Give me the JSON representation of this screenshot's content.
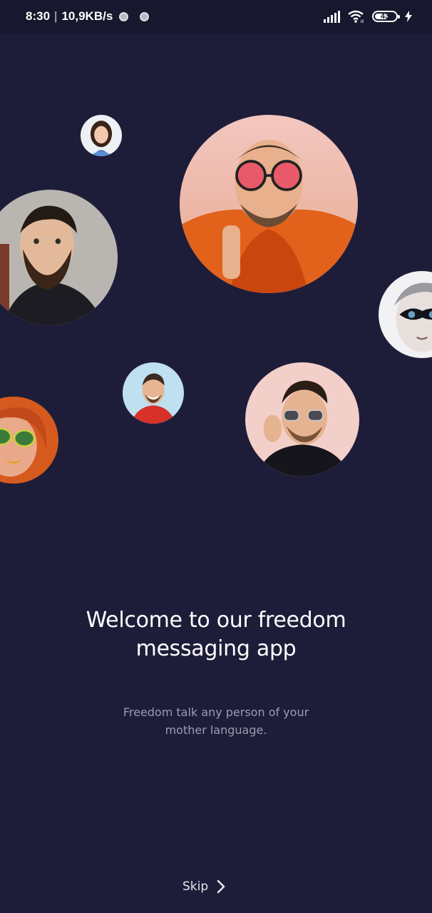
{
  "status_bar": {
    "time": "8:30",
    "speed": "10,9KB/s",
    "battery_level": "43",
    "icons": [
      "notification-dot",
      "notification-dot",
      "signal-bars",
      "wifi",
      "battery",
      "charging-bolt"
    ]
  },
  "avatars": [
    {
      "name": "woman-smiling"
    },
    {
      "name": "man-pink-sunglasses-orange-hoodie"
    },
    {
      "name": "bearded-man"
    },
    {
      "name": "face-paint-woman"
    },
    {
      "name": "smiling-man-red-shirt"
    },
    {
      "name": "man-sunglasses-pink-bg"
    },
    {
      "name": "woman-green-glasses"
    }
  ],
  "onboarding": {
    "title": "Welcome to our freedom\nmessaging app",
    "subtitle": "Freedom talk any person of your\nmother language.",
    "skip_label": "Skip"
  },
  "colors": {
    "background": "#1e1d39",
    "status_bar": "#17172d",
    "title": "#ffffff",
    "subtitle": "#9b9bb0"
  }
}
